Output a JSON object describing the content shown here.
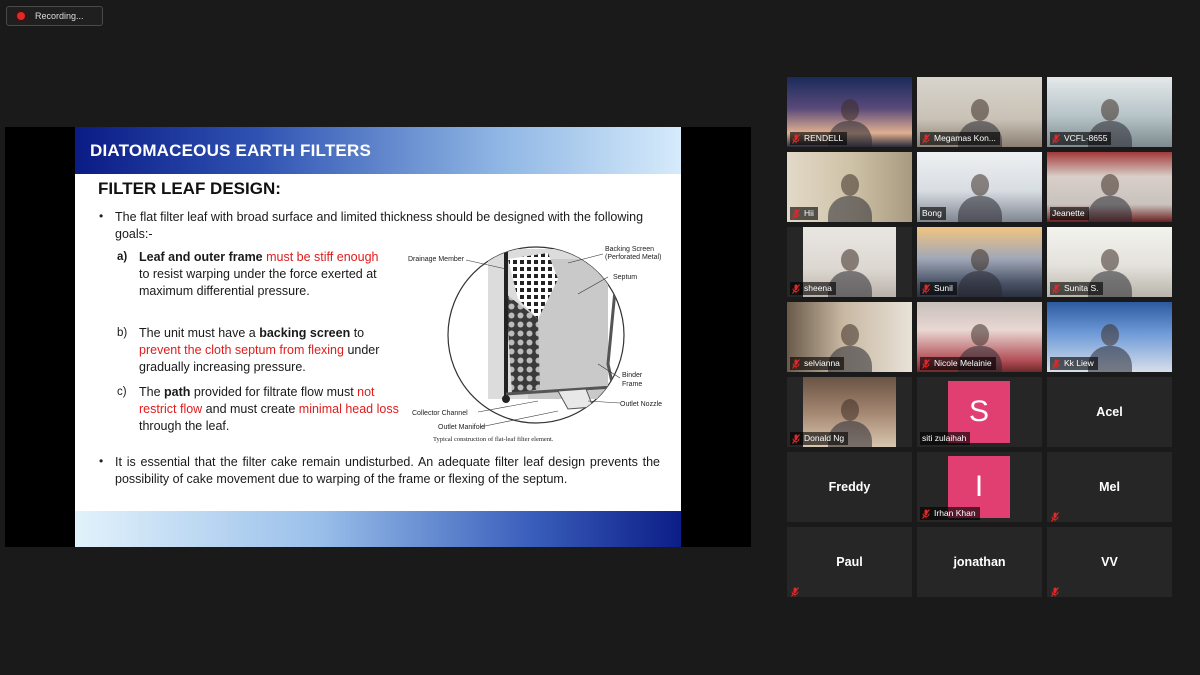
{
  "recording": {
    "label": "Recording..."
  },
  "slide": {
    "title": "DIATOMACEOUS EARTH FILTERS",
    "heading": "FILTER LEAF DESIGN:",
    "bullet1": "The flat filter leaf with broad surface and limited thickness should be designed with the following goals:-",
    "item_a": {
      "marker": "a)",
      "bold": "Leaf and outer frame",
      "red": "must be stiff enough",
      "rest": " to resist warping under the force exerted at maximum differential pressure."
    },
    "item_b": {
      "marker": "b)",
      "pre": "The unit must have a ",
      "bold": "backing screen",
      "mid": " to ",
      "red": "prevent the cloth septum from flexing",
      "rest": " under gradually increasing pressure."
    },
    "item_c": {
      "marker": "c)",
      "pre": "The ",
      "bold": "path",
      "mid": " provided for filtrate flow must ",
      "red1": "not restrict flow",
      "mid2": " and must create ",
      "red2": "minimal head loss",
      "rest": " through the leaf."
    },
    "bullet2": "It is essential that the filter cake remain undisturbed. An adequate filter leaf design prevents the possibility of cake movement due to warping of the frame or flexing of the septum.",
    "diagram": {
      "drainage": "Drainage Member",
      "backing": "Backing Screen",
      "perforated": "(Perforated Metal)",
      "septum": "Septum",
      "binder": "Binder",
      "frame": "Frame",
      "nozzle": "Outlet Nozzle",
      "collector": "Collector Channel",
      "manifold": "Outlet Manifold",
      "caption": "Typical construction of flat-leaf filter element."
    }
  },
  "participants": [
    {
      "name": "RENDELL",
      "type": "video",
      "muted": true
    },
    {
      "name": "Megamas Kon...",
      "type": "video",
      "muted": true
    },
    {
      "name": "VCFL-8655",
      "type": "video",
      "muted": true
    },
    {
      "name": "Hii",
      "type": "video",
      "muted": true
    },
    {
      "name": "Bong",
      "type": "video",
      "muted": false,
      "active": true
    },
    {
      "name": "Jeanette",
      "type": "video",
      "muted": false
    },
    {
      "name": "sheena",
      "type": "video",
      "muted": true
    },
    {
      "name": "Sunil",
      "type": "video",
      "muted": true
    },
    {
      "name": "Sunita S.",
      "type": "video",
      "muted": true
    },
    {
      "name": "selvianna",
      "type": "video",
      "muted": true
    },
    {
      "name": "Nicole Melainie",
      "type": "video",
      "muted": true
    },
    {
      "name": "Kk Liew",
      "type": "video",
      "muted": true
    },
    {
      "name": "Donald Ng",
      "type": "video",
      "muted": true
    },
    {
      "name": "siti zulaihah",
      "type": "avatar",
      "initial": "S",
      "muted": false
    },
    {
      "name": "Acel",
      "type": "name",
      "muted": false
    },
    {
      "name": "Freddy",
      "type": "name",
      "muted": false
    },
    {
      "name": "Irhan Khan",
      "type": "avatar",
      "initial": "I",
      "muted": true
    },
    {
      "name": "Mel",
      "type": "name",
      "muted": true
    },
    {
      "name": "Paul",
      "type": "name",
      "muted": true
    },
    {
      "name": "jonathan",
      "type": "name",
      "muted": false
    },
    {
      "name": "VV",
      "type": "name",
      "muted": true
    }
  ],
  "colors": {
    "muted_mic": "#e02828",
    "active_speaker": "#d6e03a",
    "avatar_bg": "#e13e72",
    "slide_bar": "#0a1b85"
  }
}
